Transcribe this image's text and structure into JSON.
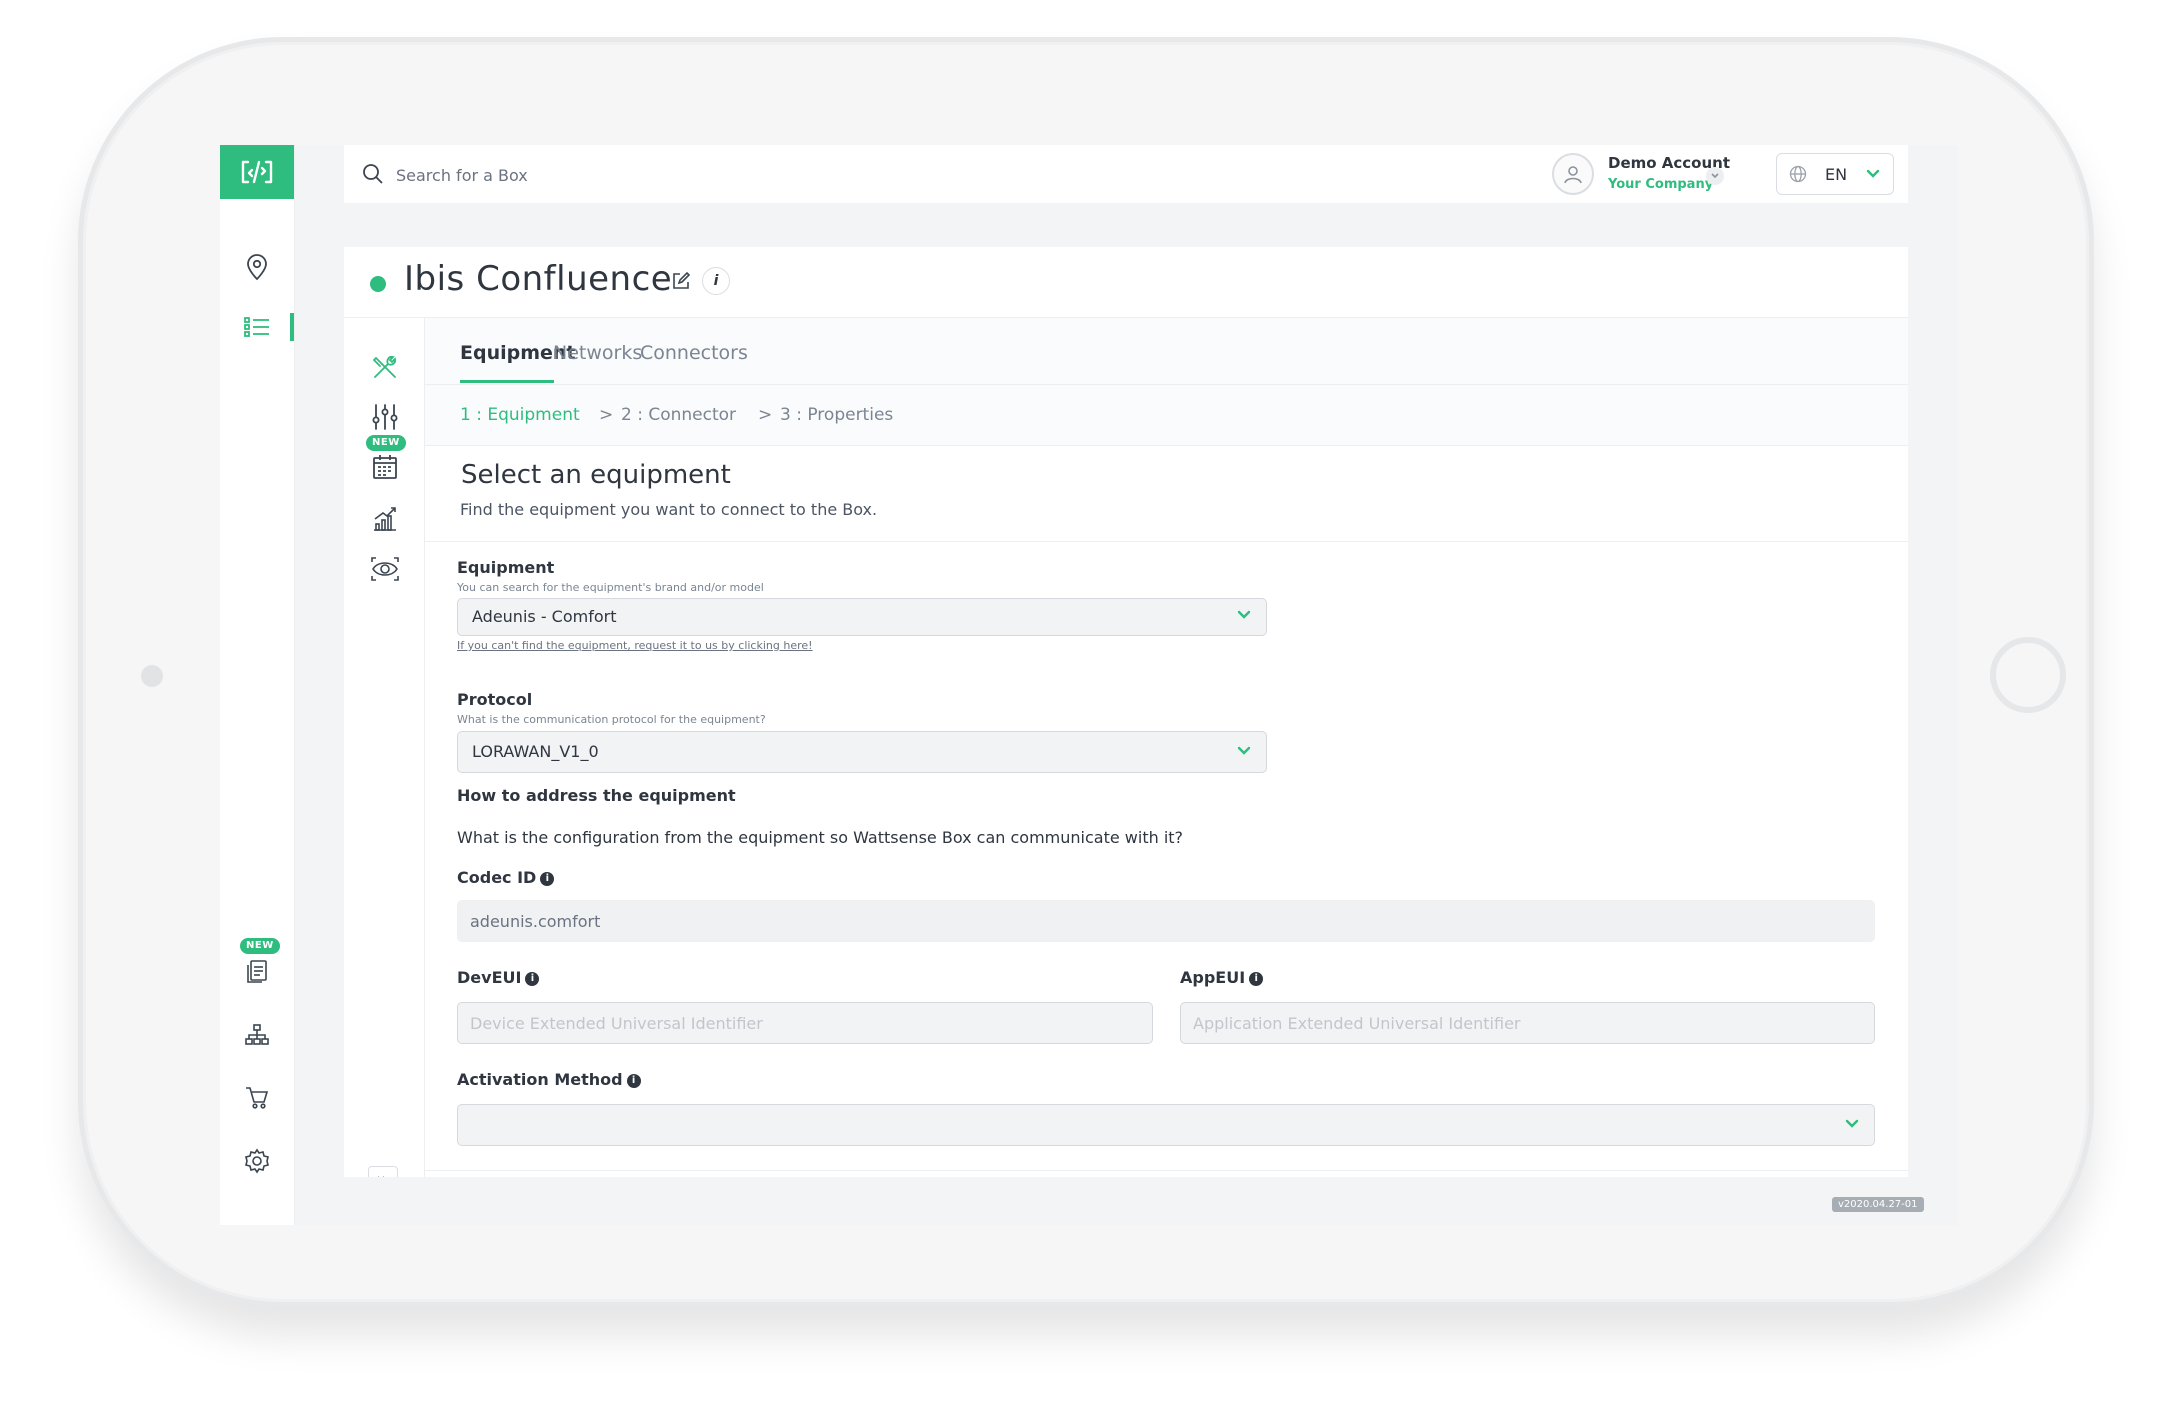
{
  "header": {
    "search_placeholder": "Search for a Box",
    "account_name": "Demo Account",
    "account_company": "Your Company",
    "language": "EN"
  },
  "rail": {
    "new_badge": "NEW"
  },
  "box": {
    "title": "Ibis Confluence",
    "info_label": "i",
    "status_color": "#2ebd7e"
  },
  "tabs": [
    {
      "label": "Equipment",
      "active": true
    },
    {
      "label": "Networks",
      "active": false
    },
    {
      "label": "Connectors",
      "active": false
    }
  ],
  "steps": {
    "step1": "1 : Equipment",
    "step2": "2 : Connector",
    "step3": "3 : Properties",
    "separator": ">"
  },
  "section": {
    "title": "Select an equipment",
    "subtitle": "Find the equipment you want to connect to the Box."
  },
  "form": {
    "equipment_label": "Equipment",
    "equipment_hint": "You can search for the equipment's brand and/or model",
    "equipment_value": "Adeunis - Comfort",
    "equipment_link": "If you can't find the equipment, request it to us by clicking here!",
    "protocol_label": "Protocol",
    "protocol_hint": "What is the communication protocol for the equipment?",
    "protocol_value": "LORAWAN_V1_0",
    "address_title": "How to address the equipment",
    "address_desc": "What is the configuration from the equipment so Wattsense Box can communicate with it?",
    "codec_label": "Codec ID",
    "codec_value": "adeunis.comfort",
    "deveui_label": "DevEUI",
    "deveui_placeholder": "Device Extended Universal Identifier",
    "appeui_label": "AppEUI",
    "appeui_placeholder": "Application Extended Universal Identifier",
    "activation_label": "Activation Method",
    "activation_value": "",
    "info_glyph": "i"
  },
  "footer": {
    "version": "v2020.04.27-01"
  },
  "colors": {
    "accent": "#2ebd7e",
    "text": "#2f3640",
    "muted": "#7b8591"
  }
}
